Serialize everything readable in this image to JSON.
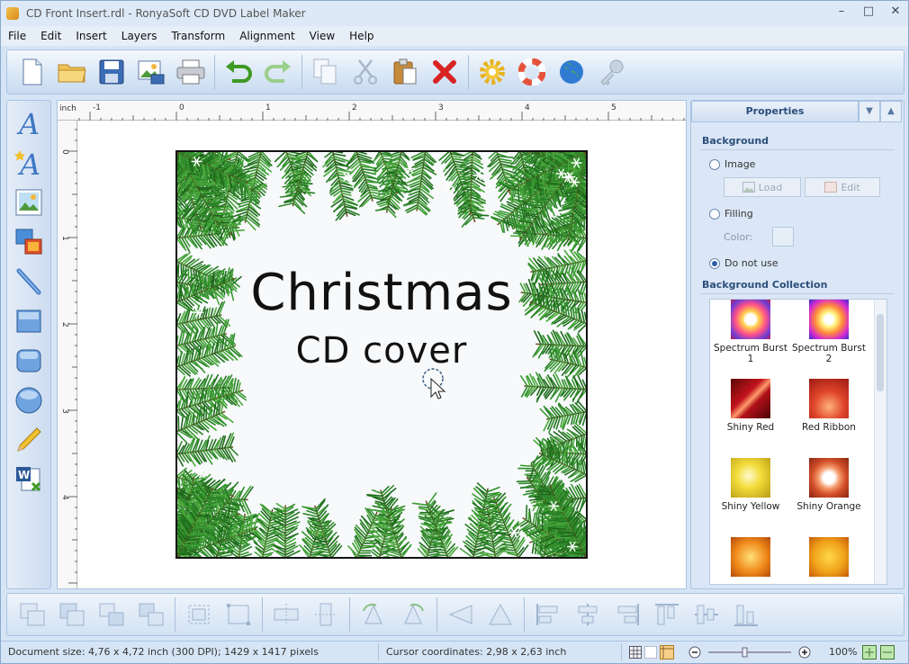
{
  "window": {
    "title": "CD Front Insert.rdl - RonyaSoft CD DVD Label Maker",
    "controls": [
      "minimize-icon",
      "maximize-icon",
      "close-icon"
    ]
  },
  "menu": [
    "File",
    "Edit",
    "Insert",
    "Layers",
    "Transform",
    "Alignment",
    "View",
    "Help"
  ],
  "toolbar": {
    "icons": [
      "new-document-icon",
      "open-folder-icon",
      "save-icon",
      "export-image-icon",
      "print-icon",
      "undo-icon",
      "redo-icon",
      "copy-icon",
      "cut-icon",
      "paste-icon",
      "delete-icon",
      "settings-gear-icon",
      "help-lifebuoy-icon",
      "web-globe-icon",
      "key-icon"
    ]
  },
  "left_tools": {
    "icons": [
      "text-tool-icon",
      "artistic-text-tool-icon",
      "image-tool-icon",
      "layers-image-tool-icon",
      "line-tool-icon",
      "rectangle-tool-icon",
      "rounded-rectangle-tool-icon",
      "ellipse-tool-icon",
      "pencil-tool-icon",
      "word-import-icon"
    ]
  },
  "ruler": {
    "unit": "inch",
    "top_labels": [
      "-1",
      "0",
      "1",
      "2",
      "3",
      "4",
      "5"
    ],
    "left_labels": [
      "0",
      "1",
      "2",
      "3",
      "4"
    ]
  },
  "canvas": {
    "title_line1": "Christmas",
    "title_line2": "CD cover"
  },
  "properties": {
    "tab_label": "Properties",
    "background_title": "Background",
    "option_image": "Image",
    "load_label": "Load",
    "edit_label": "Edit",
    "option_filling": "Filling",
    "color_label": "Color:",
    "option_do_not_use": "Do not use",
    "selected_option": "Do not use",
    "collection_title": "Background Collection",
    "collection": [
      {
        "label": "Spectrum Burst 1",
        "color": "#ff6aa0"
      },
      {
        "label": "Spectrum Burst 2",
        "color": "#f6a23a"
      },
      {
        "label": "Shiny Red",
        "color": "#b3121b"
      },
      {
        "label": "Red Ribbon",
        "color": "#d84a2a"
      },
      {
        "label": "Shiny Yellow",
        "color": "#e9cf2e"
      },
      {
        "label": "Shiny Orange",
        "color": "#e26a2e"
      },
      {
        "label": "",
        "color": "#f08a1a"
      },
      {
        "label": "",
        "color": "#f0a21a"
      }
    ]
  },
  "bottom_toolbar": {
    "icons": [
      "group-icon",
      "ungroup-icon",
      "bring-front-icon",
      "send-back-icon",
      "fit-frame-icon",
      "resize-frame-icon",
      "flip-horizontal-icon",
      "flip-vertical-icon",
      "rotate-left-icon",
      "rotate-right-icon",
      "skew-left-icon",
      "skew-right-icon",
      "align-left-icon",
      "align-center-icon",
      "align-right-icon",
      "align-top-icon",
      "align-middle-icon",
      "align-bottom-icon"
    ]
  },
  "status": {
    "document_size": "Document size: 4,76 x 4,72 inch (300 DPI); 1429 x 1417 pixels",
    "cursor": "Cursor coordinates: 2,98 x 2,63 inch",
    "zoom": "100%"
  },
  "colors": {
    "accent": "#2b4f7a",
    "pine": "#2f8a2a",
    "frame": "#111111"
  }
}
